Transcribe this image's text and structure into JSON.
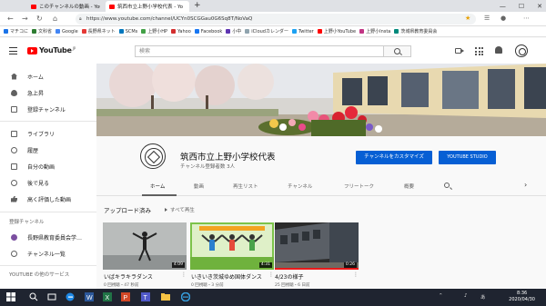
{
  "browser": {
    "tabs": [
      {
        "label": "このチャンネルの動画 - YouTub"
      },
      {
        "label": "筑西市立上野小学校代表 - Yo"
      }
    ],
    "new_tab": "+",
    "window_controls": [
      "—",
      "☐",
      "✕"
    ],
    "url": "https://www.youtube.com/channel/UCYn0SCGGau0G6Sq8T/NoVaQ",
    "bookmarks": [
      {
        "label": "マチコに",
        "color": "#1a73e8"
      },
      {
        "label": "文科省",
        "color": "#2e7d32"
      },
      {
        "label": "Google",
        "color": "#4285f4"
      },
      {
        "label": "長野県ネット",
        "color": "#e53935"
      },
      {
        "label": "SCMs",
        "color": "#0277bd"
      },
      {
        "label": "上野小HP",
        "color": "#43a047"
      },
      {
        "label": "Yahoo",
        "color": "#d32f2f"
      },
      {
        "label": "Facebook",
        "color": "#1877f2"
      },
      {
        "label": "小中",
        "color": "#5e35b1"
      },
      {
        "label": "iCloudカレンダー",
        "color": "#90a4ae"
      },
      {
        "label": "Twitter",
        "color": "#1da1f2"
      },
      {
        "label": "上野小YouTube",
        "color": "#ff0000"
      },
      {
        "label": "上野小Insta",
        "color": "#c13584"
      },
      {
        "label": "茨城県教育委員会",
        "color": "#00897b"
      }
    ]
  },
  "youtube": {
    "logo_text": "YouTube",
    "logo_region": "JP",
    "search_placeholder": "検索"
  },
  "sidebar": {
    "items": [
      {
        "label": "ホーム",
        "icon": "home-icon"
      },
      {
        "label": "急上昇",
        "icon": "fire-icon"
      },
      {
        "label": "登録チャンネル",
        "icon": "subscriptions-icon"
      },
      {
        "label": "ライブラリ",
        "icon": "library-icon"
      },
      {
        "label": "履歴",
        "icon": "history-icon"
      },
      {
        "label": "自分の動画",
        "icon": "my-videos-icon"
      },
      {
        "label": "後で見る",
        "icon": "watch-later-icon"
      },
      {
        "label": "高く評価した動画",
        "icon": "thumbs-up-icon"
      }
    ],
    "subscriptions_heading": "登録チャンネル",
    "subscriptions": [
      {
        "label": "長野県教育委員会学…"
      },
      {
        "label": "チャンネル一覧"
      }
    ],
    "more_heading": "YOUTUBE の他のサービス"
  },
  "channel": {
    "name": "筑西市立上野小学校代表",
    "subscribers": "チャンネル登録者数 3人",
    "customize_button": "チャンネルをカスタマイズ",
    "studio_button": "YOUTUBE STUDIO",
    "tabs": [
      {
        "label": "ホーム"
      },
      {
        "label": "動画"
      },
      {
        "label": "再生リスト"
      },
      {
        "label": "チャンネル"
      },
      {
        "label": "フリートーク"
      },
      {
        "label": "概要"
      }
    ],
    "active_tab": "ホーム"
  },
  "uploads": {
    "heading": "アップロード済み",
    "play_all": "すべて再生",
    "videos": [
      {
        "title": "いばキラキラダンス",
        "meta": "0 回視聴・47 秒前",
        "duration": "4:09"
      },
      {
        "title": "いきいき茨城ゆめ国体ダンス",
        "meta": "0 回視聴・3 分前",
        "duration": "4:31"
      },
      {
        "title": "4/23の様子",
        "meta": "25 回視聴・6 日前",
        "duration": "0:26"
      }
    ]
  },
  "taskbar": {
    "time": "8:36",
    "date": "2020/04/30"
  }
}
